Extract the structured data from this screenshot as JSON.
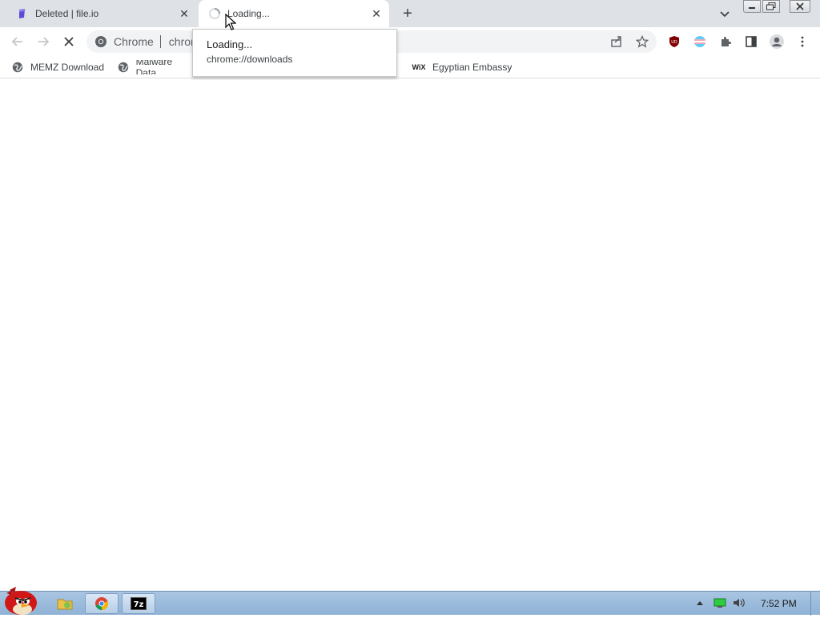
{
  "tabs": [
    {
      "title": "Deleted | file.io",
      "favicon": "fileio-icon",
      "active": false
    },
    {
      "title": "Loading...",
      "favicon": "loading-spinner-icon",
      "active": true
    }
  ],
  "toolbar": {
    "omnibox_chip_label": "Chrome",
    "omnibox_url_partial": "chron"
  },
  "tooltip": {
    "title": "Loading...",
    "url": "chrome://downloads"
  },
  "bookmarks": [
    {
      "label": "MEMZ Download",
      "icon": "globe-icon"
    },
    {
      "label": "Malware Data",
      "icon": "globe-icon"
    },
    {
      "label": "Egyptian Embassy",
      "icon": "wix-icon"
    }
  ],
  "taskbar": {
    "clock": "7:52 PM"
  },
  "colors": {
    "tabstrip": "#dee1e6",
    "omnibox": "#f1f3f4",
    "taskbar": "#a9c5e2"
  }
}
